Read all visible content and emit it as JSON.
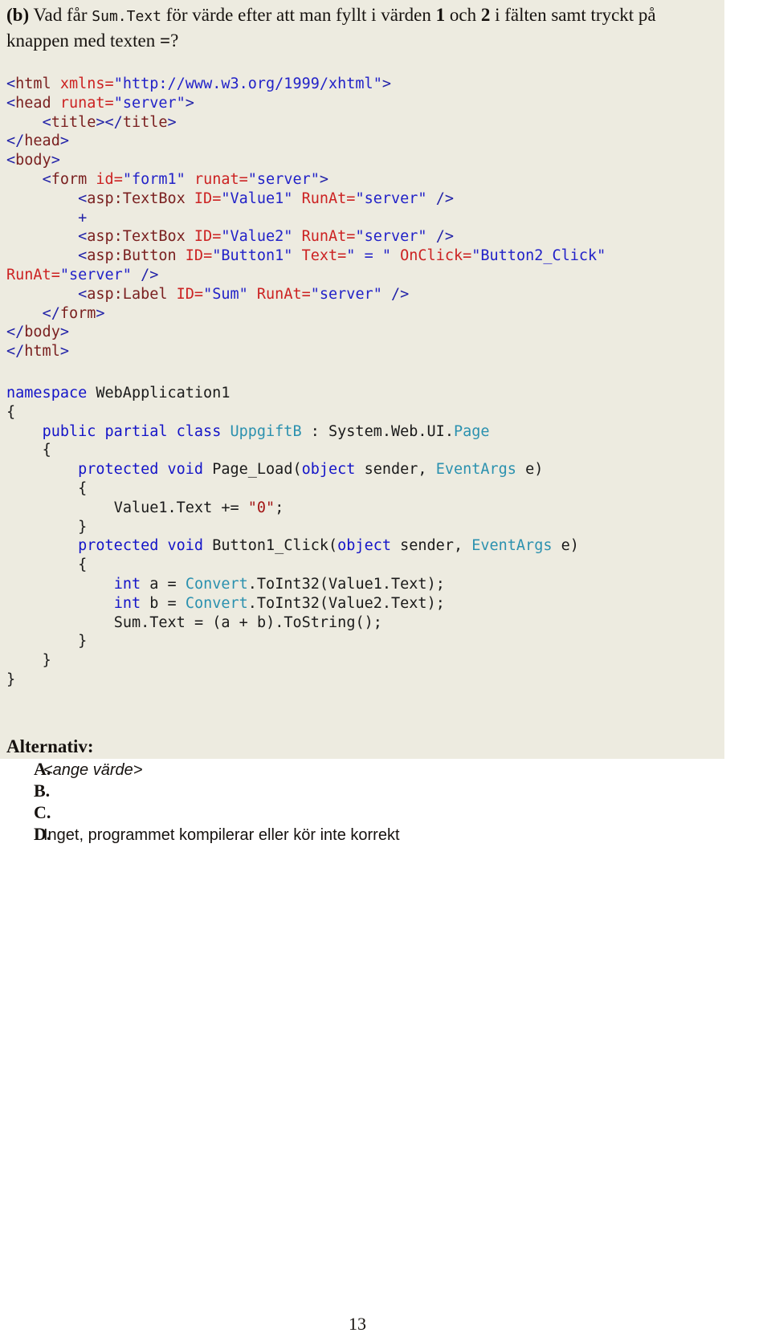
{
  "question": {
    "label": "(b)",
    "part1": " Vad får ",
    "mono_ref": "Sum.Text",
    "part2": " för värde efter att man fyllt i värden ",
    "num1": "1",
    "part3": " och ",
    "num2": "2",
    "part4": " i fälten samt tryckt på knappen med texten ",
    "eq": "=",
    "part5": "?"
  },
  "markup_code": {
    "lines": [
      "<html xmlns=\"http://www.w3.org/1999/xhtml\">",
      "<head runat=\"server\">",
      "    <title></title>",
      "</head>",
      "<body>",
      "    <form id=\"form1\" runat=\"server\">",
      "        <asp:TextBox ID=\"Value1\" RunAt=\"server\" />",
      "        +",
      "        <asp:TextBox ID=\"Value2\" RunAt=\"server\" />",
      "        <asp:Button ID=\"Button1\" Text=\" = \" OnClick=\"Button2_Click\"",
      "RunAt=\"server\" />",
      "        <asp:Label ID=\"Sum\" RunAt=\"server\" />",
      "    </form>",
      "</body>",
      "</html>"
    ]
  },
  "csharp_code": {
    "lines": [
      "namespace WebApplication1",
      "{",
      "    public partial class UppgiftB : System.Web.UI.Page",
      "    {",
      "        protected void Page_Load(object sender, EventArgs e)",
      "        {",
      "            Value1.Text += \"0\";",
      "        }",
      "        protected void Button1_Click(object sender, EventArgs e)",
      "        {",
      "            int a = Convert.ToInt32(Value1.Text);",
      "            int b = Convert.ToInt32(Value2.Text);",
      "            Sum.Text = (a + b).ToString();",
      "        }",
      "    }",
      "}"
    ]
  },
  "alternatives": {
    "title": "Alternativ:",
    "options": [
      {
        "letter": "A.",
        "text": "<ange värde>",
        "italic": true
      },
      {
        "letter": "B.",
        "text": "",
        "italic": false
      },
      {
        "letter": "C.",
        "text": "",
        "italic": false
      },
      {
        "letter": "D.",
        "text": "Inget, programmet kompilerar eller kör inte korrekt",
        "italic": false
      }
    ]
  },
  "footer": {
    "page_number": "13"
  },
  "colors": {
    "shade_background": "#EDEBE0",
    "markup_bracket": "#2222A8",
    "markup_tag": "#7A2020",
    "markup_attribute": "#CC2222",
    "markup_value": "#2222C8",
    "csharp_keyword": "#1414C8",
    "csharp_type": "#2B91AF",
    "csharp_string": "#A31515",
    "text": "#16120F"
  }
}
